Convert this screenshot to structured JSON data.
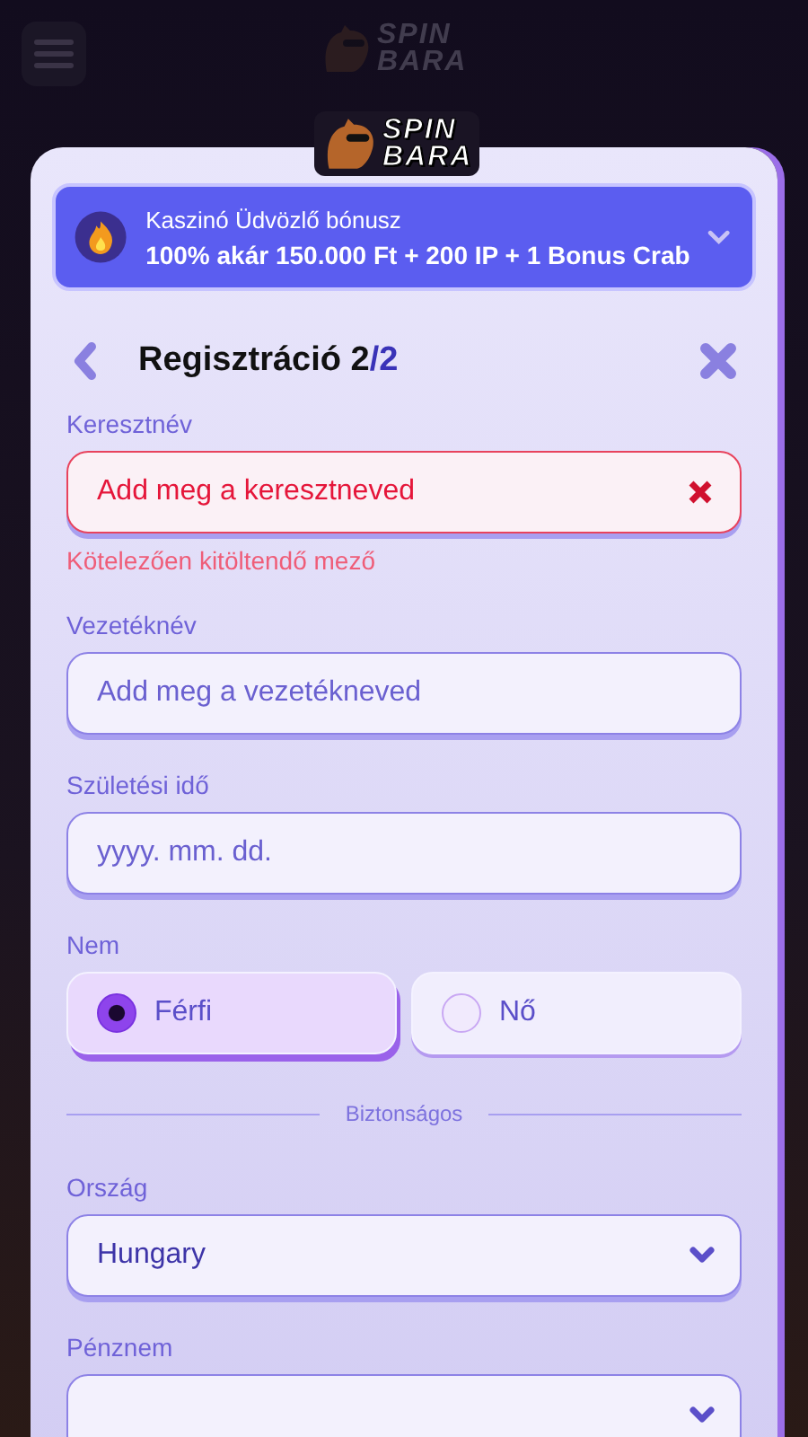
{
  "header": {
    "logo": {
      "line1": "SPIN",
      "line2": "BARA"
    }
  },
  "modal": {
    "logo": {
      "line1": "SPIN",
      "line2": "BARA"
    },
    "bonus": {
      "title": "Kaszinó Üdvözlő bónusz",
      "text": "100% akár 150.000 Ft + 200 IP + 1 Bonus Crab",
      "expanded": false
    },
    "step": {
      "title": "Regisztráció 2",
      "total": "/2"
    },
    "fields": [
      {
        "kind": "text",
        "label": "Keresztnév",
        "placeholder": "Add meg a keresztneved",
        "invalid": true,
        "error": "Kötelezően kitöltendő mező"
      },
      {
        "kind": "text",
        "label": "Vezetéknév",
        "placeholder": "Add meg a vezetékneved",
        "invalid": false
      },
      {
        "kind": "text",
        "label": "Születési idő",
        "placeholder": "yyyy. mm. dd.",
        "invalid": false
      },
      {
        "kind": "radio",
        "label": "Nem",
        "options": [
          {
            "label": "Férfi",
            "selected": true
          },
          {
            "label": "Nő",
            "selected": false
          }
        ]
      },
      {
        "kind": "divider",
        "label": "Biztonságos"
      },
      {
        "kind": "select",
        "label": "Ország",
        "value": "Hungary"
      },
      {
        "kind": "select",
        "label": "Pénznem"
      }
    ]
  }
}
